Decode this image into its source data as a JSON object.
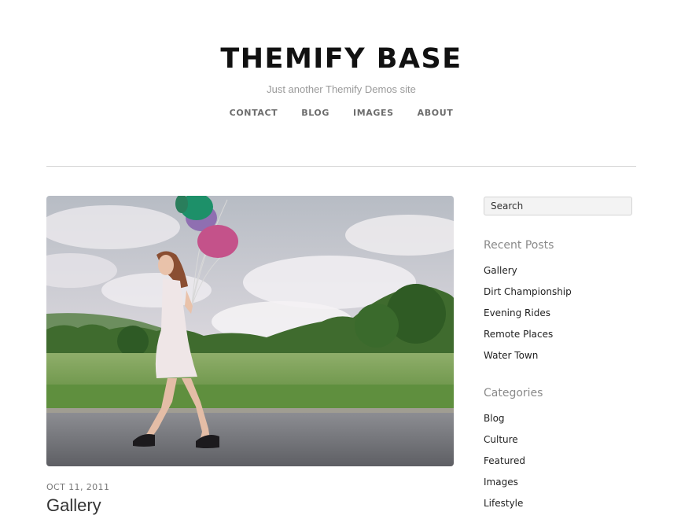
{
  "header": {
    "site_title": "THEMIFY BASE",
    "site_description": "Just another Themify Demos site"
  },
  "nav": {
    "items": [
      {
        "label": "CONTACT"
      },
      {
        "label": "BLOG"
      },
      {
        "label": "IMAGES"
      },
      {
        "label": "ABOUT"
      }
    ]
  },
  "post": {
    "date": "OCT 11, 2011",
    "title": "Gallery",
    "image_subject": "woman-walking-with-balloons"
  },
  "sidebar": {
    "search": {
      "placeholder": "Search"
    },
    "recent_posts": {
      "title": "Recent Posts",
      "items": [
        {
          "label": "Gallery"
        },
        {
          "label": "Dirt Championship"
        },
        {
          "label": "Evening Rides"
        },
        {
          "label": "Remote Places"
        },
        {
          "label": "Water Town"
        }
      ]
    },
    "categories": {
      "title": "Categories",
      "items": [
        {
          "label": "Blog"
        },
        {
          "label": "Culture"
        },
        {
          "label": "Featured"
        },
        {
          "label": "Images"
        },
        {
          "label": "Lifestyle"
        }
      ]
    }
  },
  "colors": {
    "text_dark": "#111111",
    "nav_text": "#6c6c6c",
    "muted": "#9a9a9a",
    "divider": "#d6d6d6"
  }
}
